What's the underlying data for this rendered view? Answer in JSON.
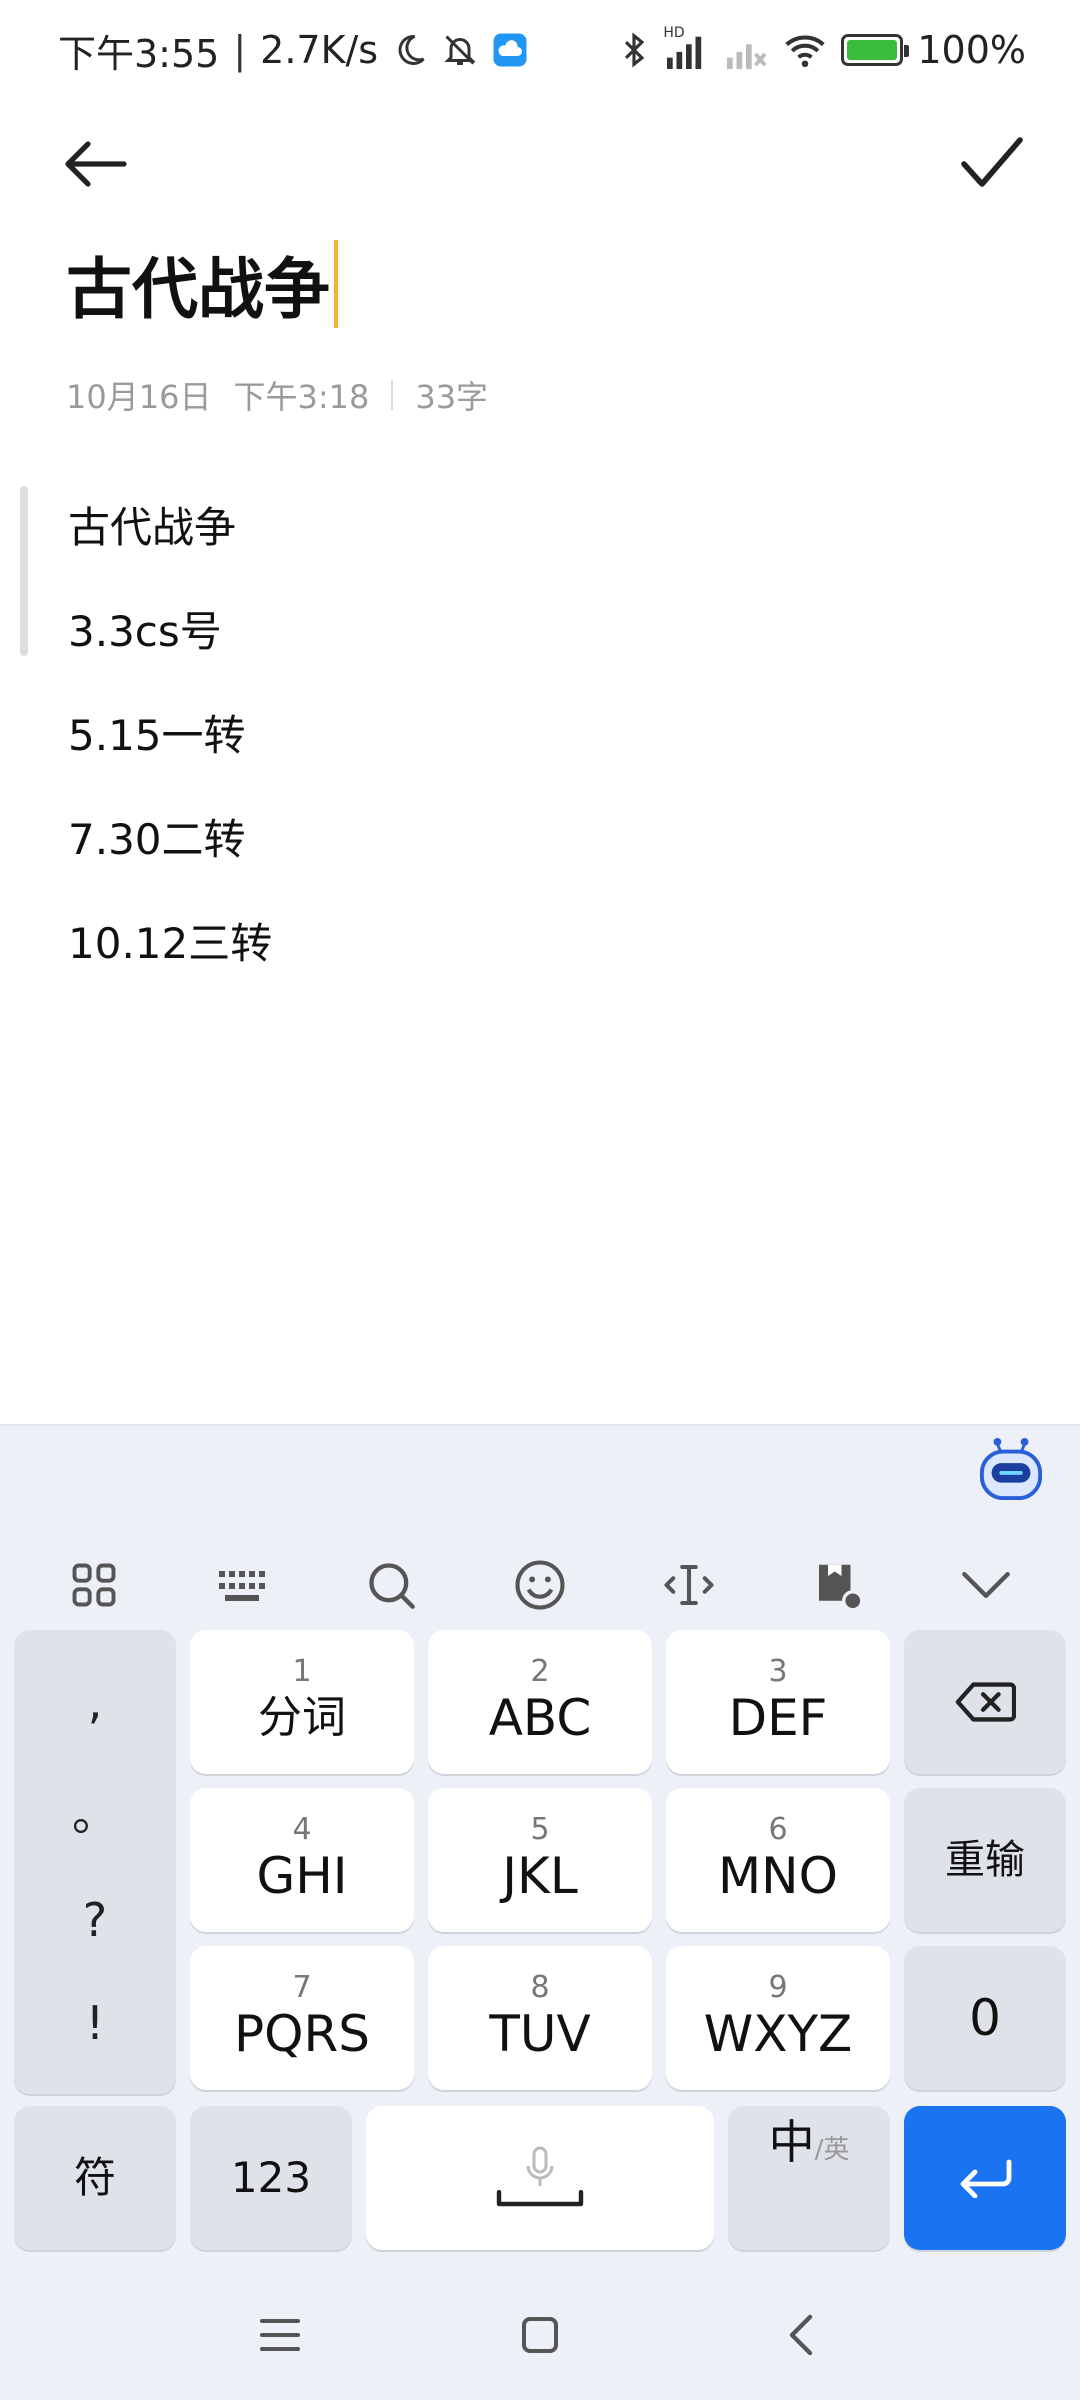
{
  "status_bar": {
    "time": "下午3:55",
    "net_speed": "2.7K/s",
    "network_hd": "HD",
    "battery": "100%",
    "battery_level": 1.0
  },
  "note": {
    "title": "古代战争",
    "date": "10月16日",
    "time": "下午3:18",
    "char_count": "33字",
    "lines": [
      "古代战争",
      "3.3cs号",
      "5.15一转",
      "7.30二转",
      "10.12三转"
    ]
  },
  "keyboard": {
    "punct": [
      ",",
      "。",
      "?",
      "!"
    ],
    "keys": [
      {
        "num": "1",
        "label": "分词"
      },
      {
        "num": "2",
        "label": "ABC"
      },
      {
        "num": "3",
        "label": "DEF"
      },
      {
        "num": "4",
        "label": "GHI"
      },
      {
        "num": "5",
        "label": "JKL"
      },
      {
        "num": "6",
        "label": "MNO"
      },
      {
        "num": "7",
        "label": "PQRS"
      },
      {
        "num": "8",
        "label": "TUV"
      },
      {
        "num": "9",
        "label": "WXYZ"
      }
    ],
    "reinput": "重输",
    "zero": "0",
    "symbols": "符",
    "numbers": "123",
    "lang_main": "中",
    "lang_sub": "/英"
  },
  "colors": {
    "caret": "#f2b233",
    "enter": "#1a73f0",
    "battery_fill": "#3bbd3b"
  }
}
